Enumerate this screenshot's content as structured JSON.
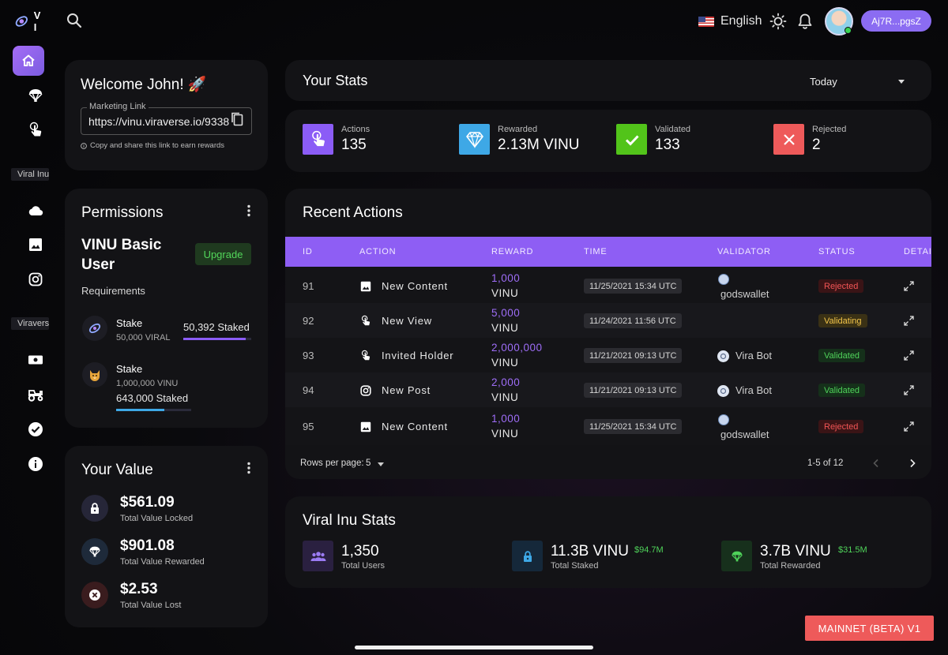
{
  "header": {
    "logo_text": "V I",
    "language": "English",
    "wallet": "Aj7R...pgsZ"
  },
  "sidebar": {
    "section_1": "Viral Inu",
    "section_2": "Viraverse"
  },
  "welcome": {
    "title": "Welcome John! 🚀",
    "link_label": "Marketing Link",
    "link_value": "https://vinu.viraverse.io/9338",
    "help": "Copy and share this link to earn rewards"
  },
  "permissions": {
    "title": "Permissions",
    "tier": "VINU Basic User",
    "upgrade": "Upgrade",
    "requirements_label": "Requirements",
    "requirements": [
      {
        "label": "Stake",
        "amount": "50,000 VIRAL",
        "staked": "50,392 Staked",
        "progress": 0.92,
        "color": "#8b5cf6"
      },
      {
        "label": "Stake",
        "amount": "1,000,000 VINU",
        "staked": "643,000 Staked",
        "progress": 0.64,
        "color": "#3ea8e6"
      }
    ]
  },
  "your_value": {
    "title": "Your Value",
    "items": [
      {
        "amount": "$561.09",
        "label": "Total Value Locked"
      },
      {
        "amount": "$901.08",
        "label": "Total Value Rewarded"
      },
      {
        "amount": "$2.53",
        "label": "Total Value Lost"
      }
    ]
  },
  "your_stats": {
    "title": "Your Stats",
    "period": "Today",
    "items": [
      {
        "label": "Actions",
        "value": "135",
        "color": "#8b5cf6"
      },
      {
        "label": "Rewarded",
        "value": "2.13M VINU",
        "color": "#3ea8e6"
      },
      {
        "label": "Validated",
        "value": "133",
        "color": "#52c41a"
      },
      {
        "label": "Rejected",
        "value": "2",
        "color": "#ee5a5a"
      }
    ]
  },
  "recent_actions": {
    "title": "Recent Actions",
    "columns": [
      "ID",
      "ACTION",
      "REWARD",
      "TIME",
      "VALIDATOR",
      "STATUS",
      "DETAI"
    ],
    "rows": [
      {
        "id": "91",
        "action": "New Content",
        "icon": "image-icon",
        "reward": "1,000",
        "unit": "VINU",
        "time": "11/25/2021 15:34 UTC",
        "validator": "godswallet",
        "status": "Rejected"
      },
      {
        "id": "92",
        "action": "New View",
        "icon": "touch-icon",
        "reward": "5,000",
        "unit": "VINU",
        "time": "11/24/2021 11:56 UTC",
        "validator": "",
        "status": "Validating"
      },
      {
        "id": "93",
        "action": "Invited Holder",
        "icon": "touch-icon",
        "reward": "2,000,000",
        "unit": "VINU",
        "time": "11/21/2021 09:13 UTC",
        "validator": "Vira Bot",
        "status": "Validated"
      },
      {
        "id": "94",
        "action": "New Post",
        "icon": "instagram-icon",
        "reward": "2,000",
        "unit": "VINU",
        "time": "11/21/2021 09:13 UTC",
        "validator": "Vira Bot",
        "status": "Validated"
      },
      {
        "id": "95",
        "action": "New Content",
        "icon": "image-icon",
        "reward": "1,000",
        "unit": "VINU",
        "time": "11/25/2021 15:34 UTC",
        "validator": "godswallet",
        "status": "Rejected"
      }
    ],
    "rows_per_page_label": "Rows per page:",
    "rows_per_page": "5",
    "pagination": "1-5 of 12"
  },
  "viral_inu_stats": {
    "title": "Viral Inu Stats",
    "items": [
      {
        "value": "1,350",
        "sub": "",
        "label": "Total Users"
      },
      {
        "value": "11.3B VINU",
        "sub": "$94.7M",
        "label": "Total Staked"
      },
      {
        "value": "3.7B VINU",
        "sub": "$31.5M",
        "label": "Total Rewarded"
      }
    ]
  },
  "network_badge": "MAINNET (BETA) V1"
}
